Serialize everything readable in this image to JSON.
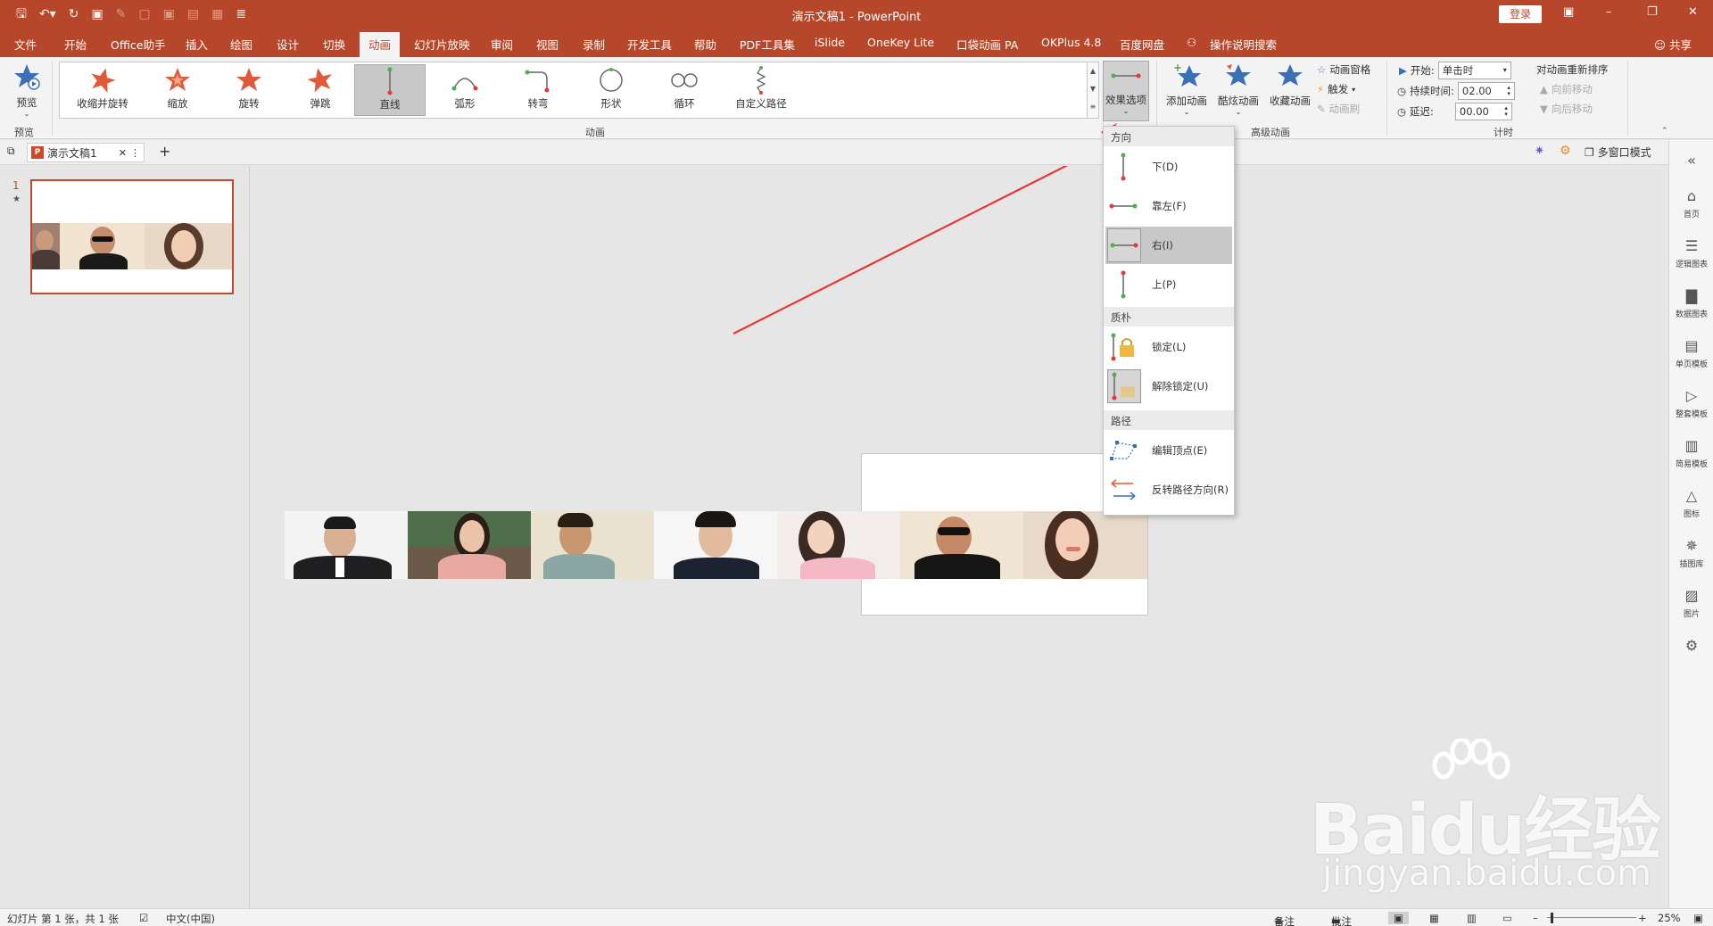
{
  "window": {
    "title": "演示文稿1 - PowerPoint",
    "login_label": "登录"
  },
  "menu": {
    "tabs": [
      "文件",
      "开始",
      "Office助手",
      "插入",
      "绘图",
      "设计",
      "切换",
      "动画",
      "幻灯片放映",
      "审阅",
      "视图",
      "录制",
      "开发工具",
      "帮助",
      "PDF工具集",
      "iSlide",
      "OneKey Lite",
      "口袋动画 PA",
      "OKPlus 4.8",
      "百度网盘",
      "操作说明搜索"
    ],
    "active_tab": "动画",
    "share_label": "共享"
  },
  "ribbon": {
    "preview": {
      "label": "预览",
      "group": "预览"
    },
    "gallery": {
      "items": [
        "收缩并旋转",
        "缩放",
        "旋转",
        "弹跳",
        "直线",
        "弧形",
        "转弯",
        "形状",
        "循环",
        "自定义路径"
      ],
      "selected": "直线",
      "group": "动画"
    },
    "effect_options_label": "效果选项",
    "advanced": {
      "add_animation": "添加动画",
      "cool_animation": "酷炫动画",
      "collect_animation": "收藏动画",
      "pane": "动画窗格",
      "trigger": "触发",
      "painter": "动画刷",
      "group": "高级动画"
    },
    "timing": {
      "start_label": "开始:",
      "start_value": "单击时",
      "duration_label": "持续时间:",
      "duration_value": "02.00",
      "delay_label": "延迟:",
      "delay_value": "00.00",
      "reorder_label": "对动画重新排序",
      "move_earlier": "向前移动",
      "move_later": "向后移动",
      "group": "计时"
    }
  },
  "docbar": {
    "doc_name": "演示文稿1",
    "multiwindow_label": "多窗口模式"
  },
  "thumbs": {
    "slide_number": "1",
    "anim_marker": "★"
  },
  "dropdown": {
    "sections": [
      "方向",
      "质朴",
      "路径"
    ],
    "items": [
      "下(D)",
      "靠左(F)",
      "右(I)",
      "上(P)",
      "锁定(L)",
      "解除锁定(U)",
      "编辑顶点(E)",
      "反转路径方向(R)"
    ],
    "selected": "右(I)"
  },
  "sidepanel": {
    "items": [
      "首页",
      "逻辑图表",
      "数据图表",
      "单页模板",
      "整套模板",
      "简易模板",
      "图标",
      "插图库",
      "图片"
    ]
  },
  "statusbar": {
    "slide_info": "幻灯片 第 1 张，共 1 张",
    "language": "中文(中国)",
    "notes": "备注",
    "comments": "批注",
    "zoom": "25%"
  },
  "watermark": {
    "main": "Baidu经验",
    "sub": "jingyan.baidu.com"
  },
  "colors": {
    "accent": "#b7472a",
    "arrow": "#e53935"
  }
}
